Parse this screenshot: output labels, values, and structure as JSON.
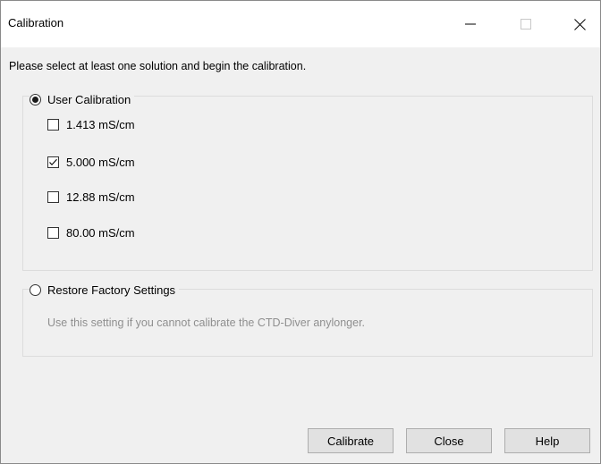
{
  "window": {
    "title": "Calibration",
    "minimize_icon": "minimize-icon",
    "maximize_icon": "maximize-icon",
    "close_icon": "close-icon"
  },
  "instruction": "Please select at least one solution and begin the calibration.",
  "user_calibration": {
    "label": "User Calibration",
    "selected": true,
    "solutions": [
      {
        "label": "1.413 mS/cm",
        "checked": false
      },
      {
        "label": "5.000 mS/cm",
        "checked": true
      },
      {
        "label": "12.88 mS/cm",
        "checked": false
      },
      {
        "label": "80.00 mS/cm",
        "checked": false
      }
    ]
  },
  "factory": {
    "label": "Restore Factory Settings",
    "selected": false,
    "hint": "Use this setting if you cannot calibrate the CTD-Diver anylonger."
  },
  "buttons": {
    "calibrate": "Calibrate",
    "close": "Close",
    "help": "Help"
  }
}
